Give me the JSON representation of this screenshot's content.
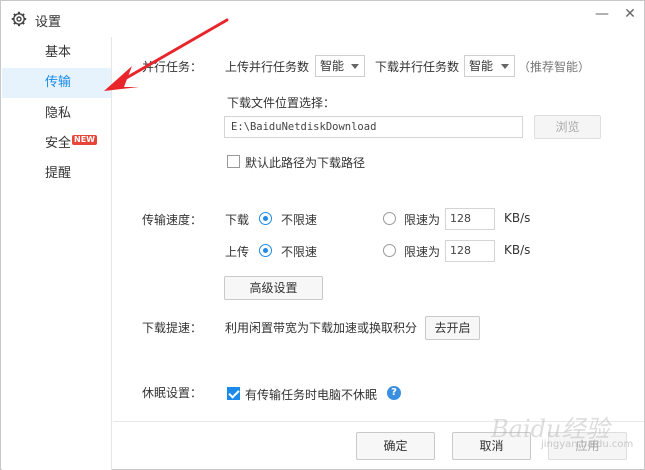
{
  "window": {
    "title": "设置",
    "minimize": "—",
    "close": "✕"
  },
  "sidebar": {
    "items": [
      {
        "label": "基本"
      },
      {
        "label": "传输"
      },
      {
        "label": "隐私"
      },
      {
        "label": "安全",
        "badge": "NEW"
      },
      {
        "label": "提醒"
      }
    ]
  },
  "parallel": {
    "label": "并行任务：",
    "upload_label": "上传并行任务数",
    "upload_value": "智能",
    "download_label": "下载并行任务数",
    "download_value": "智能",
    "hint": "（推荐智能）"
  },
  "location": {
    "label": "下载文件位置选择：",
    "path": "E:\\BaiduNetdiskDownload",
    "browse": "浏览",
    "default_checkbox": "默认此路径为下载路径"
  },
  "speed": {
    "label": "传输速度：",
    "download": {
      "label": "下载",
      "unlimited": "不限速",
      "limit": "限速为",
      "value": "128",
      "unit": "KB/s"
    },
    "upload": {
      "label": "上传",
      "unlimited": "不限速",
      "limit": "限速为",
      "value": "128",
      "unit": "KB/s"
    },
    "advanced": "高级设置"
  },
  "boost": {
    "label": "下载提速：",
    "text": "利用闲置带宽为下载加速或换取积分",
    "button": "去开启"
  },
  "sleep": {
    "label": "休眠设置：",
    "checkbox": "有传输任务时电脑不休眠",
    "help": "?"
  },
  "footer": {
    "ok": "确定",
    "cancel": "取消",
    "apply": "应用"
  },
  "watermark": {
    "brand": "Baidu经验",
    "sub": "jingyan.baidu.com"
  },
  "colors": {
    "accent": "#1a8be8",
    "badge": "#e8443a",
    "arrow": "#e8252b"
  }
}
